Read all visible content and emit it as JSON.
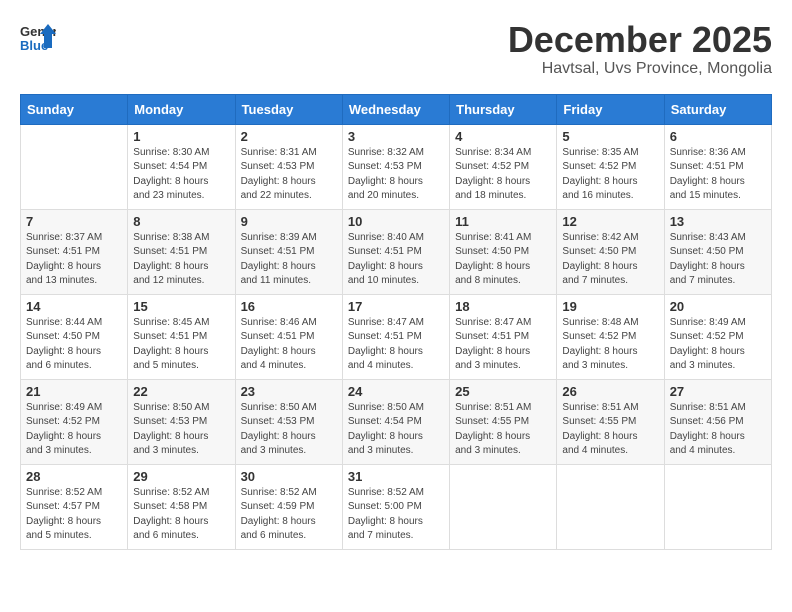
{
  "header": {
    "logo_line1": "General",
    "logo_line2": "Blue",
    "month": "December 2025",
    "location": "Havtsal, Uvs Province, Mongolia"
  },
  "days_of_week": [
    "Sunday",
    "Monday",
    "Tuesday",
    "Wednesday",
    "Thursday",
    "Friday",
    "Saturday"
  ],
  "weeks": [
    [
      {
        "day": "",
        "info": ""
      },
      {
        "day": "1",
        "info": "Sunrise: 8:30 AM\nSunset: 4:54 PM\nDaylight: 8 hours\nand 23 minutes."
      },
      {
        "day": "2",
        "info": "Sunrise: 8:31 AM\nSunset: 4:53 PM\nDaylight: 8 hours\nand 22 minutes."
      },
      {
        "day": "3",
        "info": "Sunrise: 8:32 AM\nSunset: 4:53 PM\nDaylight: 8 hours\nand 20 minutes."
      },
      {
        "day": "4",
        "info": "Sunrise: 8:34 AM\nSunset: 4:52 PM\nDaylight: 8 hours\nand 18 minutes."
      },
      {
        "day": "5",
        "info": "Sunrise: 8:35 AM\nSunset: 4:52 PM\nDaylight: 8 hours\nand 16 minutes."
      },
      {
        "day": "6",
        "info": "Sunrise: 8:36 AM\nSunset: 4:51 PM\nDaylight: 8 hours\nand 15 minutes."
      }
    ],
    [
      {
        "day": "7",
        "info": "Sunrise: 8:37 AM\nSunset: 4:51 PM\nDaylight: 8 hours\nand 13 minutes."
      },
      {
        "day": "8",
        "info": "Sunrise: 8:38 AM\nSunset: 4:51 PM\nDaylight: 8 hours\nand 12 minutes."
      },
      {
        "day": "9",
        "info": "Sunrise: 8:39 AM\nSunset: 4:51 PM\nDaylight: 8 hours\nand 11 minutes."
      },
      {
        "day": "10",
        "info": "Sunrise: 8:40 AM\nSunset: 4:51 PM\nDaylight: 8 hours\nand 10 minutes."
      },
      {
        "day": "11",
        "info": "Sunrise: 8:41 AM\nSunset: 4:50 PM\nDaylight: 8 hours\nand 8 minutes."
      },
      {
        "day": "12",
        "info": "Sunrise: 8:42 AM\nSunset: 4:50 PM\nDaylight: 8 hours\nand 7 minutes."
      },
      {
        "day": "13",
        "info": "Sunrise: 8:43 AM\nSunset: 4:50 PM\nDaylight: 8 hours\nand 7 minutes."
      }
    ],
    [
      {
        "day": "14",
        "info": "Sunrise: 8:44 AM\nSunset: 4:50 PM\nDaylight: 8 hours\nand 6 minutes."
      },
      {
        "day": "15",
        "info": "Sunrise: 8:45 AM\nSunset: 4:51 PM\nDaylight: 8 hours\nand 5 minutes."
      },
      {
        "day": "16",
        "info": "Sunrise: 8:46 AM\nSunset: 4:51 PM\nDaylight: 8 hours\nand 4 minutes."
      },
      {
        "day": "17",
        "info": "Sunrise: 8:47 AM\nSunset: 4:51 PM\nDaylight: 8 hours\nand 4 minutes."
      },
      {
        "day": "18",
        "info": "Sunrise: 8:47 AM\nSunset: 4:51 PM\nDaylight: 8 hours\nand 3 minutes."
      },
      {
        "day": "19",
        "info": "Sunrise: 8:48 AM\nSunset: 4:52 PM\nDaylight: 8 hours\nand 3 minutes."
      },
      {
        "day": "20",
        "info": "Sunrise: 8:49 AM\nSunset: 4:52 PM\nDaylight: 8 hours\nand 3 minutes."
      }
    ],
    [
      {
        "day": "21",
        "info": "Sunrise: 8:49 AM\nSunset: 4:52 PM\nDaylight: 8 hours\nand 3 minutes."
      },
      {
        "day": "22",
        "info": "Sunrise: 8:50 AM\nSunset: 4:53 PM\nDaylight: 8 hours\nand 3 minutes."
      },
      {
        "day": "23",
        "info": "Sunrise: 8:50 AM\nSunset: 4:53 PM\nDaylight: 8 hours\nand 3 minutes."
      },
      {
        "day": "24",
        "info": "Sunrise: 8:50 AM\nSunset: 4:54 PM\nDaylight: 8 hours\nand 3 minutes."
      },
      {
        "day": "25",
        "info": "Sunrise: 8:51 AM\nSunset: 4:55 PM\nDaylight: 8 hours\nand 3 minutes."
      },
      {
        "day": "26",
        "info": "Sunrise: 8:51 AM\nSunset: 4:55 PM\nDaylight: 8 hours\nand 4 minutes."
      },
      {
        "day": "27",
        "info": "Sunrise: 8:51 AM\nSunset: 4:56 PM\nDaylight: 8 hours\nand 4 minutes."
      }
    ],
    [
      {
        "day": "28",
        "info": "Sunrise: 8:52 AM\nSunset: 4:57 PM\nDaylight: 8 hours\nand 5 minutes."
      },
      {
        "day": "29",
        "info": "Sunrise: 8:52 AM\nSunset: 4:58 PM\nDaylight: 8 hours\nand 6 minutes."
      },
      {
        "day": "30",
        "info": "Sunrise: 8:52 AM\nSunset: 4:59 PM\nDaylight: 8 hours\nand 6 minutes."
      },
      {
        "day": "31",
        "info": "Sunrise: 8:52 AM\nSunset: 5:00 PM\nDaylight: 8 hours\nand 7 minutes."
      },
      {
        "day": "",
        "info": ""
      },
      {
        "day": "",
        "info": ""
      },
      {
        "day": "",
        "info": ""
      }
    ]
  ]
}
